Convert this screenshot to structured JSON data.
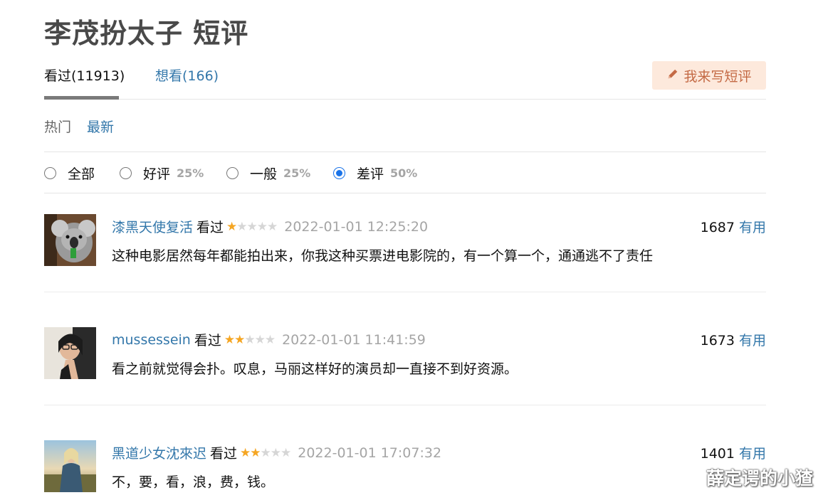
{
  "title": "李茂扮太子 短评",
  "tabs": {
    "seen": "看过(11913)",
    "want": "想看(166)"
  },
  "write_button": "我来写短评",
  "sorts": {
    "hot": "热门",
    "new": "最新"
  },
  "filters": [
    {
      "label": "全部",
      "pct": "",
      "checked": false
    },
    {
      "label": "好评",
      "pct": "25%",
      "checked": false
    },
    {
      "label": "一般",
      "pct": "25%",
      "checked": false
    },
    {
      "label": "差评",
      "pct": "50%",
      "checked": true
    }
  ],
  "comments": [
    {
      "user": "漆黑天使复活",
      "status": "看过",
      "rating": 1,
      "time": "2022-01-01 12:25:20",
      "votes": "1687",
      "useful": "有用",
      "text": "这种电影居然每年都能拍出来，你我这种买票进电影院的，有一个算一个，通通逃不了责任"
    },
    {
      "user": "mussessein",
      "status": "看过",
      "rating": 2,
      "time": "2022-01-01 11:41:59",
      "votes": "1673",
      "useful": "有用",
      "text": "看之前就觉得会扑。叹息，马丽这样好的演员却一直接不到好资源。"
    },
    {
      "user": "黑道少女沈來迟",
      "status": "看过",
      "rating": 2,
      "time": "2022-01-01 17:07:32",
      "votes": "1401",
      "useful": "有用",
      "text": "不，要，看，浪，费，钱。"
    }
  ],
  "watermark": "薛定谔的小猹",
  "colors": {
    "link": "#3377aa",
    "star": "#f5a623",
    "button_bg": "#fde9dc",
    "button_text": "#c46a45",
    "radio": "#1a73e8"
  }
}
